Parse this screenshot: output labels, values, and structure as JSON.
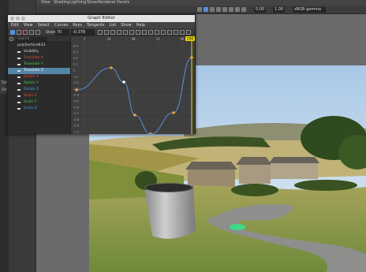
{
  "viewport": {
    "menu": [
      "View",
      "Shading",
      "Lighting",
      "Show",
      "Renderer",
      "Panels"
    ],
    "exposure": "0.00",
    "gamma": "1.00",
    "colorspace": "sRGB gamma",
    "left_tabs": [
      "",
      "Set",
      "Set"
    ]
  },
  "graph_editor": {
    "title": "Graph Editor",
    "menu": [
      "Edit",
      "View",
      "Select",
      "Curves",
      "Keys",
      "Tangents",
      "List",
      "Show",
      "Help"
    ],
    "stats_label": "Stats",
    "stats_frame": "70",
    "stats_value": "-0.378",
    "search_placeholder": "Search...",
    "outliner": [
      {
        "label": "polySurface633",
        "kind": "root"
      },
      {
        "label": "Visibility",
        "color": "#dddddd"
      },
      {
        "label": "Translate X",
        "color": "#e04848"
      },
      {
        "label": "Translate Y",
        "color": "#4cd04c"
      },
      {
        "label": "Translate Z",
        "color": "#ffffff",
        "selected": true
      },
      {
        "label": "Rotate X",
        "color": "#e04848"
      },
      {
        "label": "Rotate Y",
        "color": "#4cd04c"
      },
      {
        "label": "Rotate Z",
        "color": "#4a9ae0"
      },
      {
        "label": "Scale X",
        "color": "#e04848"
      },
      {
        "label": "Scale Y",
        "color": "#4cd04c"
      },
      {
        "label": "Scale Z",
        "color": "#4a9ae0"
      }
    ],
    "frame_ticks": [
      "1",
      "24",
      "48",
      "72",
      "96"
    ],
    "current_frame": "200",
    "value_ticks": [
      "0.4",
      "0.3",
      "0.2",
      "0.1",
      "0",
      "-0.1",
      "-0.2",
      "-0.3",
      "-0.4",
      "-0.5",
      "-0.6",
      "-0.7",
      "-0.8",
      "-0.9",
      "-1.0"
    ],
    "curve_color": "#5a8fd8",
    "key_color": "#f0a030",
    "timeline_color": "#e8d800"
  }
}
